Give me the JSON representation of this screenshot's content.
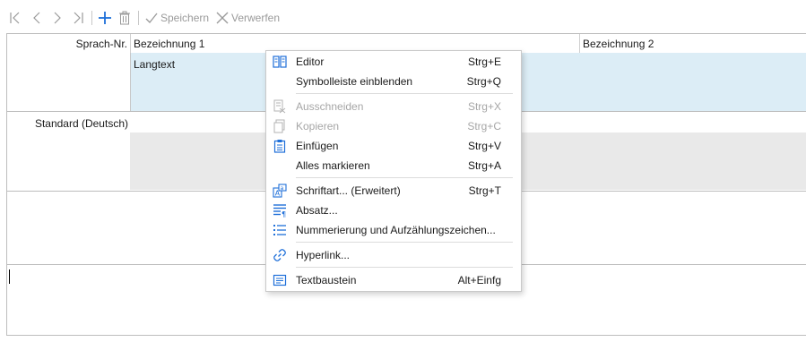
{
  "toolbar": {
    "save_label": "Speichern",
    "discard_label": "Verwerfen"
  },
  "grid": {
    "header": {
      "row_header": "Sprach-Nr.",
      "col1": "Bezeichnung 1",
      "col2": "Bezeichnung 2"
    },
    "row1": {
      "cell_text": "Langtext"
    },
    "row2": {
      "row_header": "Standard (Deutsch)"
    }
  },
  "context_menu": {
    "items": [
      {
        "label": "Editor",
        "shortcut": "Strg+E",
        "icon": "editor-icon",
        "enabled": true
      },
      {
        "label": "Symbolleiste einblenden",
        "shortcut": "Strg+Q",
        "icon": "",
        "enabled": true
      },
      {
        "label": "Ausschneiden",
        "shortcut": "Strg+X",
        "icon": "cut-icon",
        "enabled": false
      },
      {
        "label": "Kopieren",
        "shortcut": "Strg+C",
        "icon": "copy-icon",
        "enabled": false
      },
      {
        "label": "Einfügen",
        "shortcut": "Strg+V",
        "icon": "paste-icon",
        "enabled": true
      },
      {
        "label": "Alles markieren",
        "shortcut": "Strg+A",
        "icon": "",
        "enabled": true
      },
      {
        "label": "Schriftart... (Erweitert)",
        "shortcut": "Strg+T",
        "icon": "font-icon",
        "enabled": true
      },
      {
        "label": "Absatz...",
        "shortcut": "",
        "icon": "paragraph-icon",
        "enabled": true
      },
      {
        "label": "Nummerierung und Aufzählungszeichen...",
        "shortcut": "",
        "icon": "list-icon",
        "enabled": true
      },
      {
        "label": "Hyperlink...",
        "shortcut": "",
        "icon": "link-icon",
        "enabled": true
      },
      {
        "label": "Textbaustein",
        "shortcut": "Alt+Einfg",
        "icon": "text-block-icon",
        "enabled": true
      }
    ]
  },
  "colors": {
    "accent": "#1e6fd9",
    "selection_row": "#dcedf6",
    "disabled_text": "#a6a6a6"
  }
}
